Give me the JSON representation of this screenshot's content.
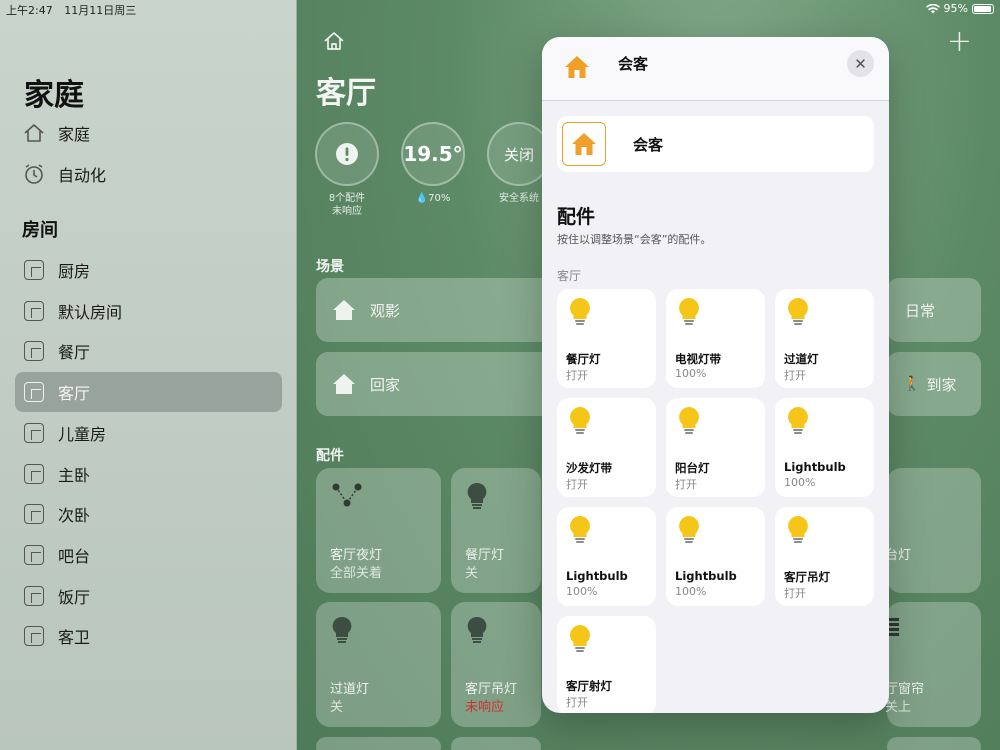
{
  "status": {
    "time": "上午2:47",
    "date": "11月11日周三",
    "battery": "95%"
  },
  "sidebar": {
    "title": "家庭",
    "nav": [
      {
        "label": "家庭",
        "icon": "house-icon"
      },
      {
        "label": "自动化",
        "icon": "clock-icon"
      }
    ],
    "rooms_heading": "房间",
    "rooms": [
      "厨房",
      "默认房间",
      "餐厅",
      "客厅",
      "儿童房",
      "主卧",
      "次卧",
      "吧台",
      "饭厅",
      "客卫"
    ],
    "selected_room": "客厅"
  },
  "main": {
    "title": "客厅",
    "stats": [
      {
        "value": "!",
        "caption": "8个配件\n未响应"
      },
      {
        "value": "19.5°",
        "caption": "💧70%"
      },
      {
        "value": "关闭",
        "caption": "安全系统"
      }
    ],
    "scenes_heading": "场景",
    "scenes": [
      {
        "label": "观影"
      },
      {
        "label": "日常"
      },
      {
        "label": "回家"
      },
      {
        "label": "到家"
      }
    ],
    "accessories_heading": "配件",
    "tiles": [
      {
        "name": "客厅夜灯",
        "status": "全部关着"
      },
      {
        "name": "餐厅灯",
        "status": "关"
      },
      {
        "name": "台灯",
        "status": ""
      },
      {
        "name": "过道灯",
        "status": "关"
      },
      {
        "name": "客厅吊灯",
        "status": "未响应"
      },
      {
        "name": "厅窗帘",
        "status": "关上"
      }
    ]
  },
  "modal": {
    "header_title": "会客",
    "scene_name": "会客",
    "accessories_title": "配件",
    "accessories_subtitle": "按住以调整场景“会客”的配件。",
    "room_label": "客厅",
    "items": [
      {
        "name": "餐厅灯",
        "status": "打开"
      },
      {
        "name": "电视灯带",
        "status": "100%"
      },
      {
        "name": "过道灯",
        "status": "打开"
      },
      {
        "name": "沙发灯带",
        "status": "打开"
      },
      {
        "name": "阳台灯",
        "status": "打开"
      },
      {
        "name": "Lightbulb",
        "status": "100%"
      },
      {
        "name": "Lightbulb",
        "status": "100%"
      },
      {
        "name": "Lightbulb",
        "status": "100%"
      },
      {
        "name": "客厅吊灯",
        "status": "打开"
      },
      {
        "name": "客厅射灯",
        "status": "打开"
      }
    ]
  },
  "colors": {
    "accent_orange": "#f0a029",
    "bulb_yellow": "#f5c518",
    "alert_red": "#d0312d"
  }
}
